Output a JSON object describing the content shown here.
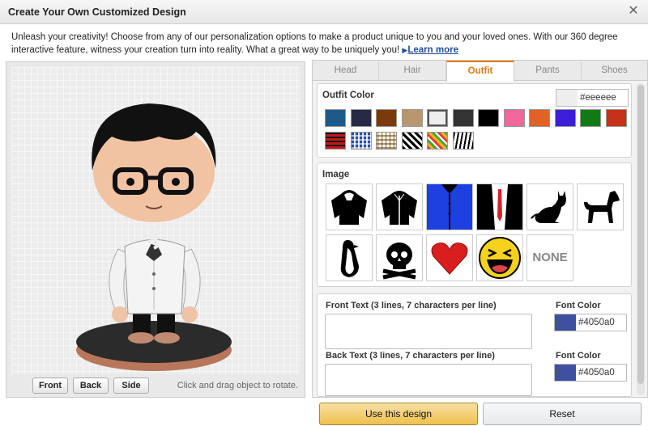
{
  "window": {
    "title": "Create Your Own Customized Design",
    "close_glyph": "✕"
  },
  "intro": {
    "text": "Unleash your creativity! Choose from any of our personalization options to make a product unique to you and your loved ones. With our 360 degree interactive feature, witness your creation turn into reality. What a great way to be uniquely you!",
    "link_arrow": "▶",
    "link": "Learn more"
  },
  "preview": {
    "views": [
      "Front",
      "Back",
      "Side"
    ],
    "hint": "Click and drag object to rotate."
  },
  "tabs": [
    {
      "label": "Head",
      "active": false
    },
    {
      "label": "Hair",
      "active": false
    },
    {
      "label": "Outfit",
      "active": true
    },
    {
      "label": "Pants",
      "active": false
    },
    {
      "label": "Shoes",
      "active": false
    }
  ],
  "outfit_color": {
    "heading": "Outfit Color",
    "selected_hex": "#eeeeee",
    "solid_swatches": [
      "#1d5a8a",
      "#262a45",
      "#7a3a0c",
      "#b89670",
      "#eeeeee",
      "#333333",
      "#000000",
      "#f0689b",
      "#e06226",
      "#3b1ed6",
      "#117a15",
      "#c33219"
    ],
    "pattern_swatches": [
      "plaid-red",
      "plaid-blue",
      "plaid-tan",
      "houndstooth",
      "stripes-rainbow",
      "zebra"
    ]
  },
  "image": {
    "heading": "Image",
    "items": [
      "hoodie-icon",
      "jacket-icon",
      "blue-suit-icon",
      "tuxedo-icon",
      "cat-icon",
      "dog-icon",
      "penguin-icon",
      "skull-crossbones-icon",
      "heart-icon",
      "laughing-face-icon",
      "none-option"
    ],
    "none_label": "NONE"
  },
  "text": {
    "front_label": "Front Text (3 lines, 7 characters per line)",
    "back_label": "Back Text (3 lines, 7 characters per line)",
    "front_value": "",
    "back_value": "",
    "font_color_label": "Font Color",
    "front_font_color": "#4050a0",
    "back_font_color": "#4050a0"
  },
  "actions": {
    "use": "Use this design",
    "reset": "Reset"
  }
}
